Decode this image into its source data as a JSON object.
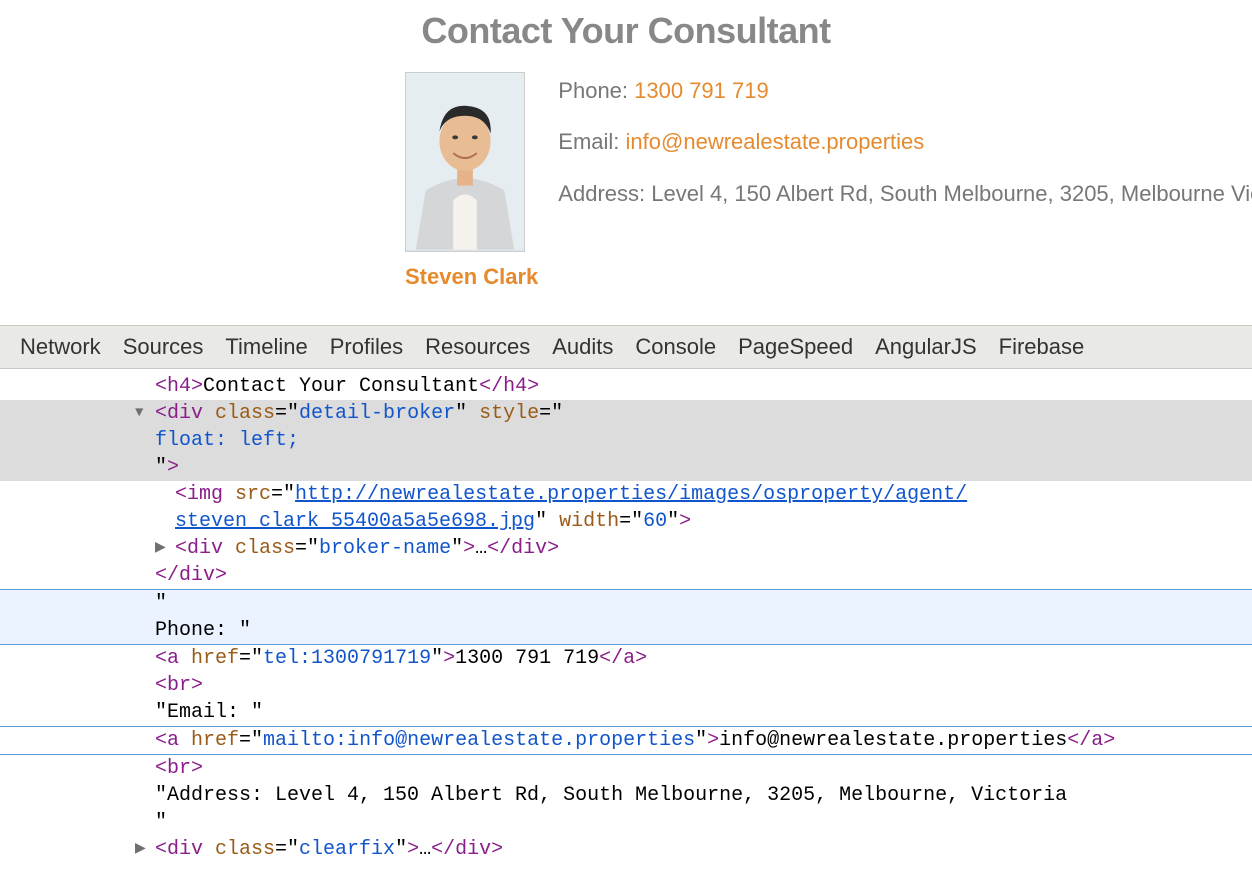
{
  "heading": "Contact Your Consultant",
  "broker": {
    "name": "Steven Clark"
  },
  "contact": {
    "phone_label": "Phone: ",
    "phone_value": "1300 791 719",
    "email_label": "Email: ",
    "email_value": "info@newrealestate.properties",
    "address_label": "Address: ",
    "address_value": "Level 4, 150 Albert Rd, South Melbourne, 3205, Melbourne Victoria"
  },
  "devtools": {
    "tabs": {
      "network": "Network",
      "sources": "Sources",
      "timeline": "Timeline",
      "profiles": "Profiles",
      "resources": "Resources",
      "audits": "Audits",
      "console": "Console",
      "pagespeed": "PageSpeed",
      "angularjs": "AngularJS",
      "firebase": "Firebase"
    }
  },
  "dom": {
    "h4_open": "<h4>",
    "h4_text": "Contact Your Consultant",
    "h4_close": "</h4>",
    "div_open": "<div",
    "class_attr": " class",
    "eq": "=\"",
    "detail_broker": "detail-broker",
    "style_attr": " style",
    "close_q_open": "\"",
    "float_left": "    float: left;",
    "div_tag_close": ">",
    "img_open": "<img",
    "src_attr": " src",
    "img_url_1": "http://newrealestate.properties/images/osproperty/agent/",
    "img_url_2": "steven_clark_55400a5a5e698.jpg",
    "width_attr": " width",
    "width_val": "60",
    "img_close": ">",
    "bn_div_open": "<div",
    "broker_name_class": "broker-name",
    "ellipsis": "…",
    "div_close": "</div>",
    "quote": "\"",
    "phone_text_node": "                                    Phone: \"",
    "a_open": "<a",
    "href_attr": " href",
    "tel_href": "tel:1300791719",
    "phone_link_text": "1300 791 719",
    "a_close": "</a>",
    "br": "<br>",
    "email_text_node": "\"Email: \"",
    "mailto_href": "mailto:info@newrealestate.properties",
    "email_link_text": "info@newrealestate.properties",
    "address_text_node": "\"Address: Level 4, 150 Albert Rd, South Melbourne, 3205, Melbourne, Victoria",
    "trailing_quote_line": "                            \"",
    "clearfix": "clearfix"
  }
}
